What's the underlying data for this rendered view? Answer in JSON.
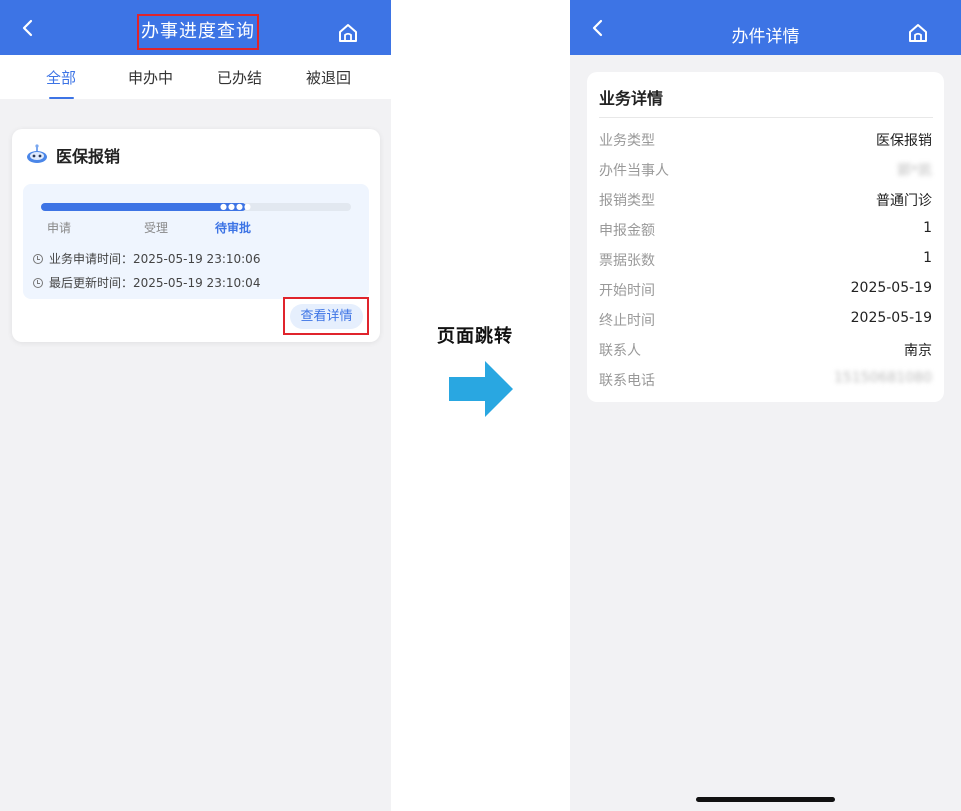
{
  "left": {
    "title": "办事进度查询",
    "tabs": [
      {
        "label": "全部",
        "active": true
      },
      {
        "label": "申办中",
        "active": false
      },
      {
        "label": "已办结",
        "active": false
      },
      {
        "label": "被退回",
        "active": false
      }
    ],
    "card": {
      "title": "医保报销",
      "progress": 0.66,
      "steps": [
        "申请",
        "受理",
        "待审批"
      ],
      "apply_time": "业务申请时间：2025-05-19 23:10:06",
      "update_time": "最后更新时间：2025-05-19 23:10:04",
      "detail_button": "查看详情"
    }
  },
  "middle": {
    "label": "页面跳转"
  },
  "right": {
    "title": "办件详情",
    "section_title": "业务详情",
    "rows": [
      {
        "key": "业务类型",
        "value": "医保报销"
      },
      {
        "key": "办件当事人",
        "value": "郭*凯"
      },
      {
        "key": "报销类型",
        "value": "普通门诊"
      },
      {
        "key": "申报金额",
        "value": "1"
      },
      {
        "key": "票据张数",
        "value": "1"
      },
      {
        "key": "开始时间",
        "value": "2025-05-19"
      },
      {
        "key": "终止时间",
        "value": "2025-05-19"
      },
      {
        "key": "联系人",
        "value": "南京"
      },
      {
        "key": "联系电话",
        "value": "15150681080"
      }
    ]
  },
  "colors": {
    "brand": "#3d74e5",
    "highlight_box": "#e0242c",
    "arrow": "#29a7e1"
  },
  "icons": [
    "back-icon",
    "home-icon",
    "medical-robot-icon",
    "clock-icon",
    "arrow-right-icon"
  ]
}
